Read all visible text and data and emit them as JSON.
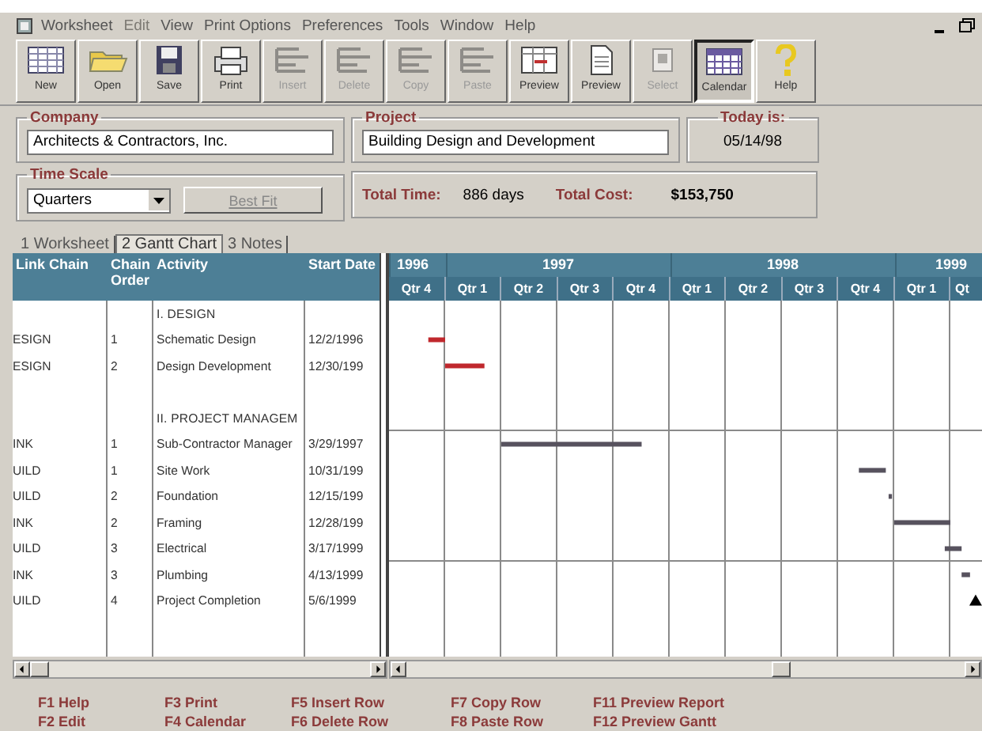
{
  "menu": [
    {
      "label": "Worksheet",
      "disabled": false
    },
    {
      "label": "Edit",
      "disabled": true
    },
    {
      "label": "View",
      "disabled": false
    },
    {
      "label": "Print Options",
      "disabled": false
    },
    {
      "label": "Preferences",
      "disabled": false
    },
    {
      "label": "Tools",
      "disabled": false
    },
    {
      "label": "Window",
      "disabled": false
    },
    {
      "label": "Help",
      "disabled": false
    }
  ],
  "toolbar": [
    {
      "label": "New",
      "kind": "grid",
      "disabled": false,
      "selected": false
    },
    {
      "label": "Open",
      "kind": "folder",
      "disabled": false,
      "selected": false
    },
    {
      "label": "Save",
      "kind": "disk",
      "disabled": false,
      "selected": false
    },
    {
      "label": "Print",
      "kind": "printer",
      "disabled": false,
      "selected": false
    },
    {
      "label": "Insert",
      "kind": "insert",
      "disabled": true,
      "selected": false
    },
    {
      "label": "Delete",
      "kind": "delete",
      "disabled": true,
      "selected": false
    },
    {
      "label": "Copy",
      "kind": "copy",
      "disabled": true,
      "selected": false
    },
    {
      "label": "Paste",
      "kind": "paste",
      "disabled": true,
      "selected": false
    },
    {
      "label": "Preview",
      "kind": "gantt",
      "disabled": false,
      "selected": false
    },
    {
      "label": "Preview",
      "kind": "page",
      "disabled": false,
      "selected": false
    },
    {
      "label": "Select",
      "kind": "select",
      "disabled": true,
      "selected": false
    },
    {
      "label": "Calendar",
      "kind": "calendar",
      "disabled": false,
      "selected": true
    },
    {
      "label": "Help",
      "kind": "help",
      "disabled": false,
      "selected": false
    }
  ],
  "company": {
    "label": "Company",
    "value": "Architects & Contractors, Inc."
  },
  "project": {
    "label": "Project",
    "value": "Building Design and Development"
  },
  "today": {
    "label": "Today is:",
    "value": "05/14/98"
  },
  "time_scale": {
    "label": "Time Scale",
    "value": "Quarters",
    "button": "Best Fit"
  },
  "totals": {
    "time_label": "Total Time:",
    "time": "886 days",
    "cost_label": "Total Cost:",
    "cost": "$153,750"
  },
  "tabs": [
    {
      "label": "1 Worksheet",
      "selected": false
    },
    {
      "label": "2 Gantt Chart",
      "selected": true
    },
    {
      "label": "3 Notes",
      "selected": false
    }
  ],
  "table": {
    "columns": [
      "Link Chain",
      "Chain Order",
      "Activity",
      "Start Date"
    ],
    "rows": [
      {
        "kind": "section",
        "activity": "I. DESIGN"
      },
      {
        "kind": "task",
        "link": "ESIGN",
        "order": "1",
        "activity": "Schematic Design",
        "start": "12/2/1996"
      },
      {
        "kind": "task",
        "link": "ESIGN",
        "order": "2",
        "activity": "Design Development",
        "start": "12/30/199"
      },
      {
        "kind": "blank"
      },
      {
        "kind": "section",
        "activity": "II. PROJECT MANAGEM"
      },
      {
        "kind": "task",
        "link": "INK",
        "order": "1",
        "activity": "Sub-Contractor Manager",
        "start": "3/29/1997"
      },
      {
        "kind": "task",
        "link": "UILD",
        "order": "1",
        "activity": "Site Work",
        "start": "10/31/199"
      },
      {
        "kind": "task",
        "link": "UILD",
        "order": "2",
        "activity": "Foundation",
        "start": "12/15/199"
      },
      {
        "kind": "task",
        "link": "INK",
        "order": "2",
        "activity": "Framing",
        "start": "12/28/199"
      },
      {
        "kind": "task",
        "link": "UILD",
        "order": "3",
        "activity": "Electrical",
        "start": "3/17/1999"
      },
      {
        "kind": "task",
        "link": "INK",
        "order": "3",
        "activity": "Plumbing",
        "start": "4/13/1999"
      },
      {
        "kind": "task",
        "link": "UILD",
        "order": "4",
        "activity": "Project Completion",
        "start": "5/6/1999"
      }
    ]
  },
  "gantt": {
    "years": [
      {
        "label": "1996",
        "quarters": [
          "Qtr 4"
        ]
      },
      {
        "label": "1997",
        "quarters": [
          "Qtr 1",
          "Qtr 2",
          "Qtr 3",
          "Qtr 4"
        ]
      },
      {
        "label": "1998",
        "quarters": [
          "Qtr 1",
          "Qtr 2",
          "Qtr 3",
          "Qtr 4"
        ]
      },
      {
        "label": "1999",
        "quarters": [
          "Qtr 1",
          "Qt"
        ]
      }
    ],
    "kind": "picture"
  },
  "footer": [
    [
      "F1 Help",
      "F2 Edit"
    ],
    [
      "F3 Print",
      "F4 Calendar"
    ],
    [
      "F5 Insert Row",
      "F6 Delete Row"
    ],
    [
      "F7 Copy Row",
      "F8 Paste Row"
    ],
    [
      "F11 Preview Report",
      "F12 Preview Gantt"
    ]
  ]
}
